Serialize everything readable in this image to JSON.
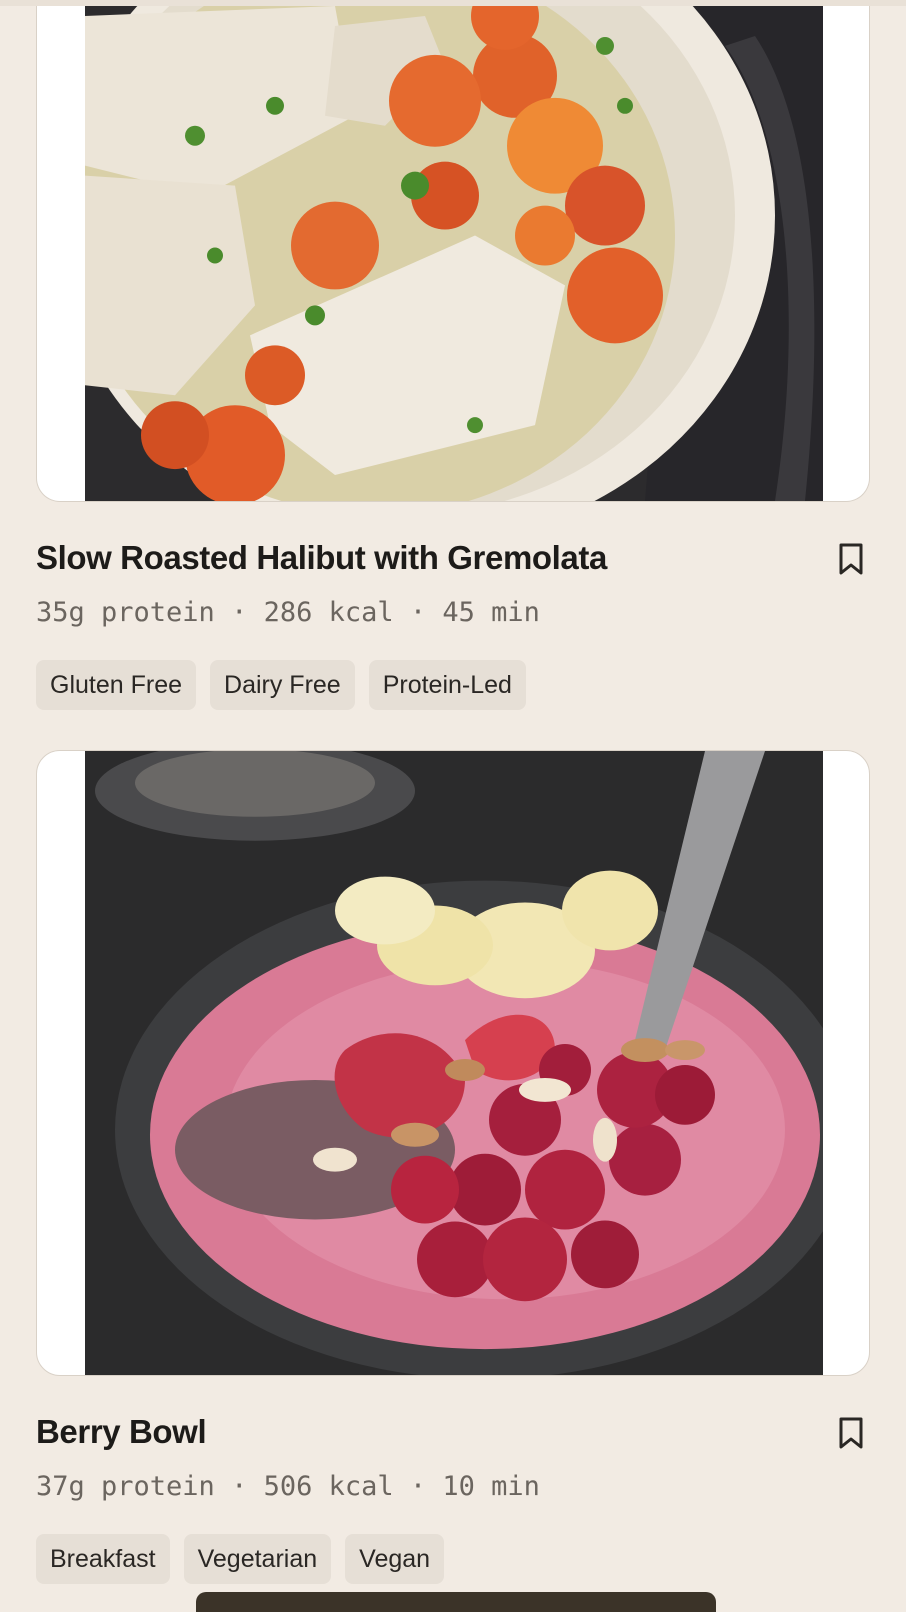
{
  "recipes": [
    {
      "title": "Slow Roasted Halibut with Gremolata",
      "meta": "35g protein · 286 kcal · 45 min",
      "tags": [
        "Gluten Free",
        "Dairy Free",
        "Protein-Led"
      ]
    },
    {
      "title": "Berry Bowl",
      "meta": "37g protein · 506 kcal · 10 min",
      "tags": [
        "Breakfast",
        "Vegetarian",
        "Vegan"
      ]
    }
  ],
  "icons": {
    "bookmark": "bookmark-icon"
  },
  "colors": {
    "background": "#f2ebe3",
    "tag_background": "#e6dfd6",
    "title": "#1d1b19",
    "meta": "#6b655f"
  }
}
